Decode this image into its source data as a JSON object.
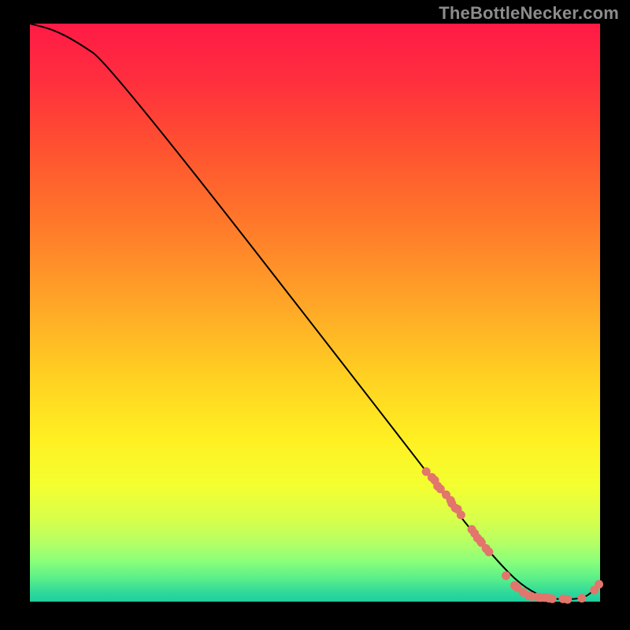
{
  "watermark": "TheBottleNecker.com",
  "plot": {
    "inner_x": 38,
    "inner_y": 30,
    "inner_w": 724,
    "inner_h": 734,
    "gradient_stops": [
      {
        "offset": 0.0,
        "color": "#ff1a46"
      },
      {
        "offset": 0.1,
        "color": "#ff2f3e"
      },
      {
        "offset": 0.22,
        "color": "#ff5330"
      },
      {
        "offset": 0.35,
        "color": "#ff7a2a"
      },
      {
        "offset": 0.48,
        "color": "#ffa428"
      },
      {
        "offset": 0.6,
        "color": "#ffcd22"
      },
      {
        "offset": 0.72,
        "color": "#fff022"
      },
      {
        "offset": 0.8,
        "color": "#f3ff30"
      },
      {
        "offset": 0.86,
        "color": "#d6ff4c"
      },
      {
        "offset": 0.9,
        "color": "#b3ff66"
      },
      {
        "offset": 0.93,
        "color": "#8aff7a"
      },
      {
        "offset": 0.96,
        "color": "#5aef8a"
      },
      {
        "offset": 0.985,
        "color": "#2ed89a"
      },
      {
        "offset": 1.0,
        "color": "#1fcfa0"
      }
    ],
    "point_color": "#e2756c",
    "line_color": "#000000"
  },
  "chart_data": {
    "type": "line",
    "title": "",
    "xlabel": "",
    "ylabel": "",
    "xlim": [
      0,
      100
    ],
    "ylim": [
      0,
      100
    ],
    "series": [
      {
        "name": "curve",
        "x": [
          0,
          4,
          8,
          14,
          70,
          76,
          82,
          86,
          90,
          93,
          97,
          99,
          100
        ],
        "values": [
          100,
          99,
          97,
          93,
          22,
          14,
          7,
          3,
          0.7,
          0.4,
          0.5,
          2,
          3
        ]
      }
    ],
    "data_points": [
      {
        "x": 69.5,
        "y": 22.5
      },
      {
        "x": 70.5,
        "y": 21.5
      },
      {
        "x": 71.0,
        "y": 21.0
      },
      {
        "x": 71.5,
        "y": 20.0
      },
      {
        "x": 72.0,
        "y": 19.5
      },
      {
        "x": 73.0,
        "y": 18.5
      },
      {
        "x": 73.8,
        "y": 17.5
      },
      {
        "x": 74.0,
        "y": 17.0
      },
      {
        "x": 74.6,
        "y": 16.2
      },
      {
        "x": 75.0,
        "y": 16.0
      },
      {
        "x": 75.6,
        "y": 15.0
      },
      {
        "x": 77.5,
        "y": 12.5
      },
      {
        "x": 78.0,
        "y": 11.8
      },
      {
        "x": 78.5,
        "y": 11.0
      },
      {
        "x": 79.0,
        "y": 10.5
      },
      {
        "x": 79.2,
        "y": 10.2
      },
      {
        "x": 80.0,
        "y": 9.2
      },
      {
        "x": 80.5,
        "y": 8.6
      },
      {
        "x": 83.5,
        "y": 4.5
      },
      {
        "x": 85.0,
        "y": 2.8
      },
      {
        "x": 85.5,
        "y": 2.4
      },
      {
        "x": 86.5,
        "y": 1.6
      },
      {
        "x": 87.5,
        "y": 1.0
      },
      {
        "x": 88.0,
        "y": 0.9
      },
      {
        "x": 89.0,
        "y": 0.8
      },
      {
        "x": 89.5,
        "y": 0.7
      },
      {
        "x": 90.3,
        "y": 0.7
      },
      {
        "x": 91.0,
        "y": 0.6
      },
      {
        "x": 91.6,
        "y": 0.5
      },
      {
        "x": 93.5,
        "y": 0.5
      },
      {
        "x": 94.3,
        "y": 0.4
      },
      {
        "x": 96.8,
        "y": 0.6
      },
      {
        "x": 99.0,
        "y": 2.0
      },
      {
        "x": 99.8,
        "y": 3.0
      }
    ]
  }
}
